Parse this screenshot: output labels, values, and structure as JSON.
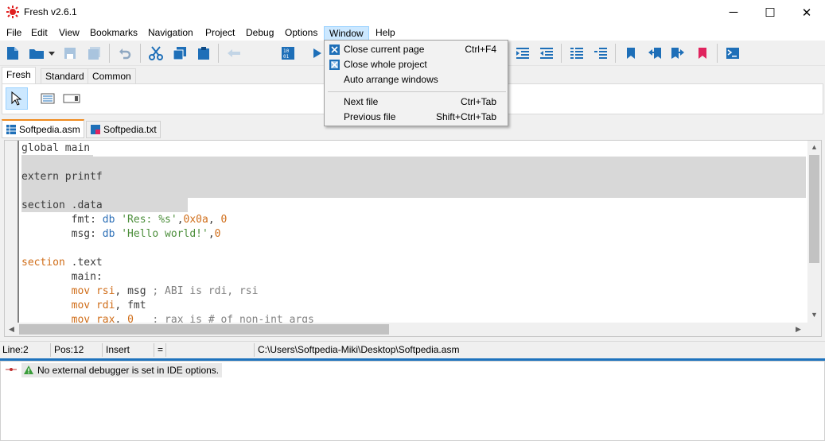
{
  "window": {
    "title": "Fresh v2.6.1",
    "minimize": "─",
    "maximize": "☐",
    "close": "✕"
  },
  "menu": {
    "items": [
      "File",
      "Edit",
      "View",
      "Bookmarks",
      "Navigation",
      "Project",
      "Debug",
      "Options",
      "Window",
      "Help"
    ],
    "active": "Window"
  },
  "window_menu": {
    "items": [
      {
        "label": "Close current page",
        "shortcut": "Ctrl+F4",
        "icon": "close-page-icon"
      },
      {
        "label": "Close whole project",
        "shortcut": "",
        "icon": "close-project-icon"
      },
      {
        "label": "Auto arrange windows",
        "shortcut": "",
        "icon": ""
      },
      {
        "label": "Next file",
        "shortcut": "Ctrl+Tab",
        "icon": ""
      },
      {
        "label": "Previous file",
        "shortcut": "Shift+Ctrl+Tab",
        "icon": ""
      }
    ]
  },
  "palette_tabs": [
    "Fresh",
    "Standard",
    "Common"
  ],
  "file_tabs": [
    "Softpedia.asm",
    "Softpedia.txt"
  ],
  "code": {
    "l1": "global main",
    "l3": "extern printf",
    "l5": "section .data",
    "l6a": "        fmt: ",
    "l6b": "db",
    "l6c": " ",
    "l6d": "'Res: %s'",
    "l6e": ",",
    "l6f": "0x0a",
    "l6g": ", ",
    "l6h": "0",
    "l7a": "        msg: ",
    "l7b": "db",
    "l7c": " ",
    "l7d": "'Hello world!'",
    "l7e": ",",
    "l7f": "0",
    "l9a": "section",
    "l9b": " .text",
    "l10": "        main:",
    "l11a": "        ",
    "l11b": "mov",
    "l11c": " ",
    "l11d": "rsi",
    "l11e": ", msg ",
    "l11f": "; ABI is rdi, rsi",
    "l12a": "        ",
    "l12b": "mov",
    "l12c": " ",
    "l12d": "rdi",
    "l12e": ", fmt",
    "l13a": "        ",
    "l13b": "mov",
    "l13c": " ",
    "l13d": "rax",
    "l13e": ", ",
    "l13f": "0",
    "l13g": "   ",
    "l13h": "; rax is # of non-int args"
  },
  "status": {
    "line": "Line:2",
    "pos": "Pos:12",
    "mode": "Insert",
    "modified": "=",
    "path": "C:\\Users\\Softpedia-Miki\\Desktop\\Softpedia.asm"
  },
  "messages": [
    "No external debugger is set in IDE options."
  ]
}
